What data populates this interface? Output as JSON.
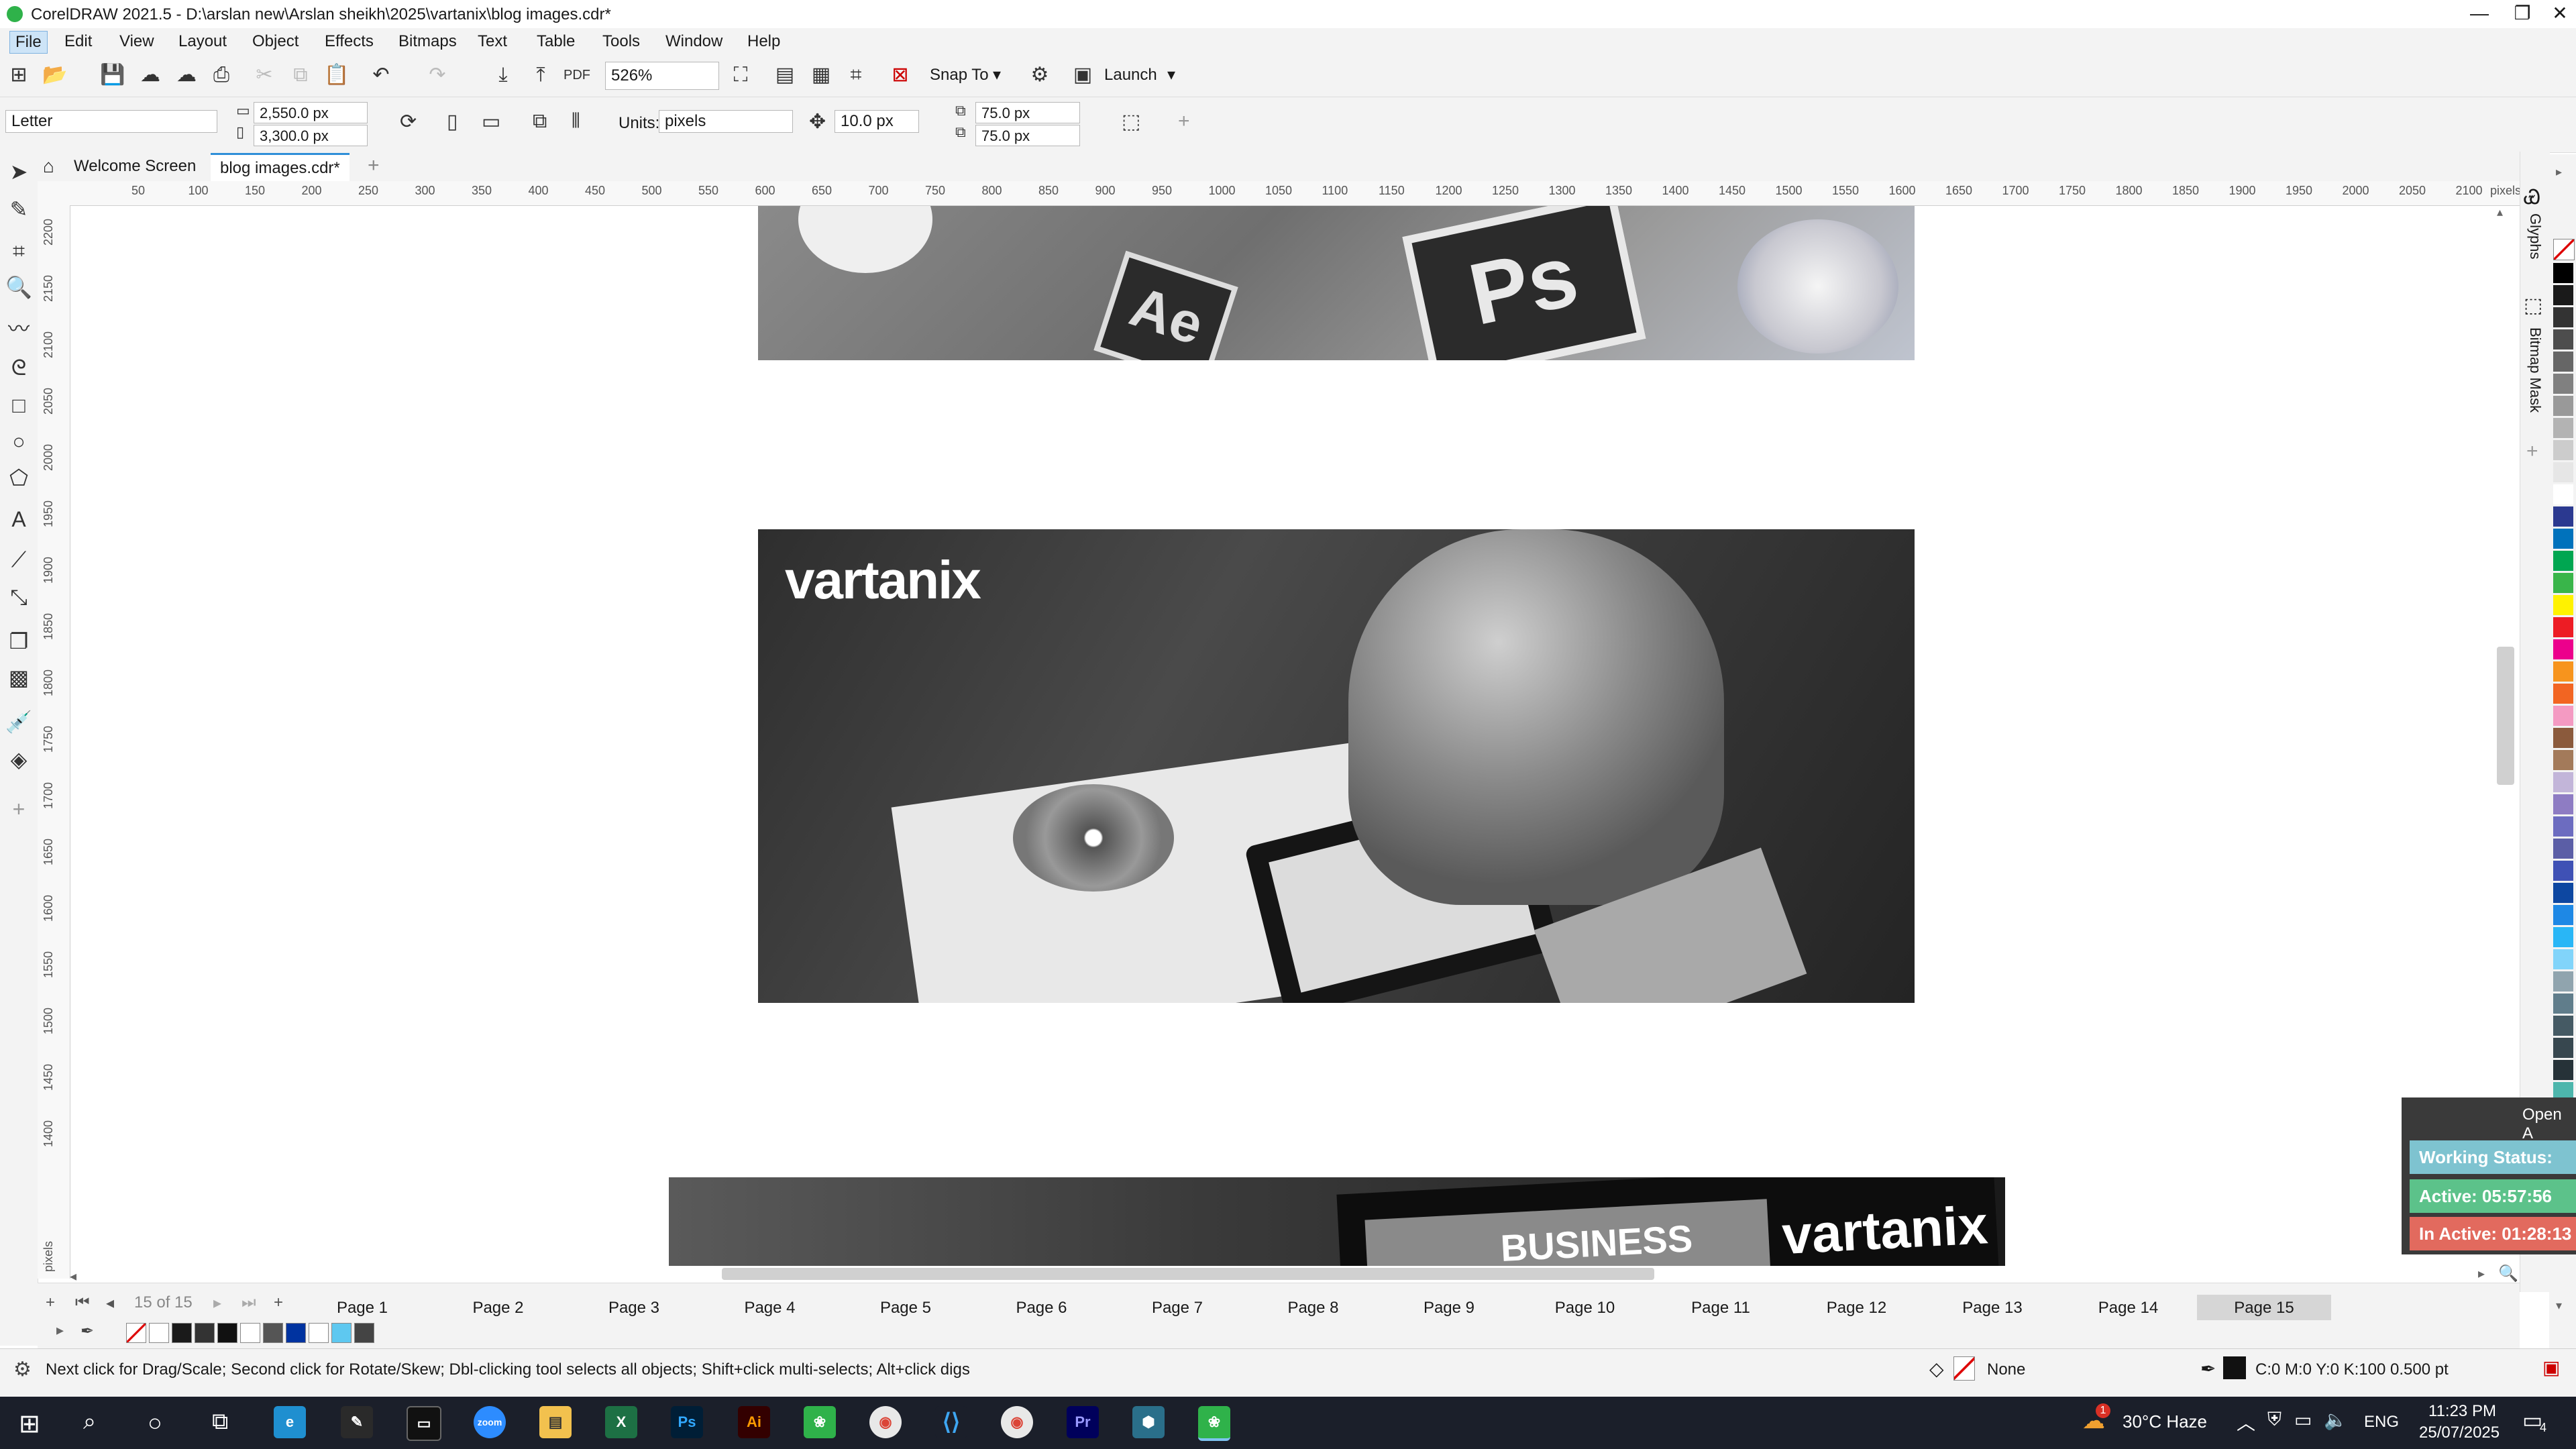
{
  "window": {
    "title": "CorelDRAW 2021.5 - D:\\arslan new\\Arslan sheikh\\2025\\vartanix\\blog images.cdr*",
    "minimize": "—",
    "restore": "❐",
    "close": "✕"
  },
  "menu": [
    "File",
    "Edit",
    "View",
    "Layout",
    "Object",
    "Effects",
    "Bitmaps",
    "Text",
    "Table",
    "Tools",
    "Window",
    "Help"
  ],
  "toolbar": {
    "zoom": "526%",
    "snap_to": "Snap To",
    "launch": "Launch"
  },
  "property_bar": {
    "page_size": "Letter",
    "width": "2,550.0 px",
    "height": "3,300.0 px",
    "units_label": "Units:",
    "units_value": "pixels",
    "nudge": "10.0 px",
    "dup_x": "75.0 px",
    "dup_y": "75.0 px"
  },
  "tabs": {
    "welcome": "Welcome Screen",
    "document": "blog images.cdr*"
  },
  "ruler": {
    "h_ticks": [
      "50",
      "100",
      "150",
      "200",
      "250",
      "300",
      "350",
      "400",
      "450",
      "500",
      "550",
      "600",
      "650",
      "700",
      "750",
      "800",
      "850",
      "900",
      "950",
      "1000",
      "1050",
      "1100",
      "1150",
      "1200",
      "1250",
      "1300",
      "1350",
      "1400",
      "1450",
      "1500",
      "1550",
      "1600",
      "1650",
      "1700",
      "1750",
      "1800",
      "1850",
      "1900",
      "1950",
      "2000",
      "2050",
      "2100"
    ],
    "h_unit": "pixels",
    "v_ticks": [
      "2200",
      "2150",
      "2100",
      "2050",
      "2000",
      "1950",
      "1900",
      "1850",
      "1800",
      "1750",
      "1700",
      "1650",
      "1600",
      "1550",
      "1500",
      "1450",
      "1400"
    ],
    "v_unit": "pixels"
  },
  "canvas": {
    "image1_labels": [
      "Ps",
      "Ae"
    ],
    "image2_logo": "vartanix",
    "image3_text": "BUSINESS",
    "image3_logo": "vartanix"
  },
  "pages": {
    "counter": "15 of 15",
    "tabs": [
      "Page 1",
      "Page 2",
      "Page 3",
      "Page 4",
      "Page 5",
      "Page 6",
      "Page 7",
      "Page 8",
      "Page 9",
      "Page 10",
      "Page 11",
      "Page 12",
      "Page 13",
      "Page 14",
      "Page 15"
    ],
    "active": "Page 15"
  },
  "document_palette": [
    "#ffffff",
    "#1a1a1a",
    "#333333",
    "#111111",
    "#ffffff",
    "#555555",
    "#0033a0",
    "#ffffff",
    "#5ec8f0",
    "#444444"
  ],
  "status": {
    "hint": "Next click for Drag/Scale; Second click for Rotate/Skew; Dbl-clicking tool selects all objects; Shift+click multi-selects; Alt+click digs",
    "fill": "None",
    "outline": "C:0 M:0 Y:0 K:100  0.500 pt"
  },
  "dockers": [
    "Glyphs",
    "Bitmap Mask"
  ],
  "palette_colors": [
    "#000000",
    "#1a1a1a",
    "#333333",
    "#4d4d4d",
    "#666666",
    "#808080",
    "#999999",
    "#b3b3b3",
    "#cccccc",
    "#e6e6e6",
    "#ffffff",
    "#2b3990",
    "#0072bc",
    "#00a651",
    "#39b54a",
    "#fff200",
    "#ed1c24",
    "#ec008c",
    "#f7941d",
    "#f26522",
    "#f49ac2",
    "#8b5a3c",
    "#a37a5a",
    "#c2b5d9",
    "#8e7cc3",
    "#6c6cc0",
    "#5b5ea6",
    "#3f51b5",
    "#0d47a1",
    "#1e88e5",
    "#29b6f6",
    "#81d4fa",
    "#90a4ae",
    "#607d8b",
    "#455a64",
    "#37474f",
    "#263238",
    "#4db6ac",
    "#26a69a",
    "#00897b"
  ],
  "widget": {
    "header": "Open A",
    "working": "Working Status: Acti",
    "active": "Active: 05:57:56",
    "inactive": "In Active: 01:28:13"
  },
  "taskbar": {
    "weather": "30°C  Haze",
    "lang": "ENG",
    "time": "11:23 PM",
    "date": "25/07/2025",
    "notif_badge": "1",
    "notif_count": "4",
    "apps": [
      "zoom",
      "Ps",
      "Ai",
      "Pr"
    ]
  }
}
